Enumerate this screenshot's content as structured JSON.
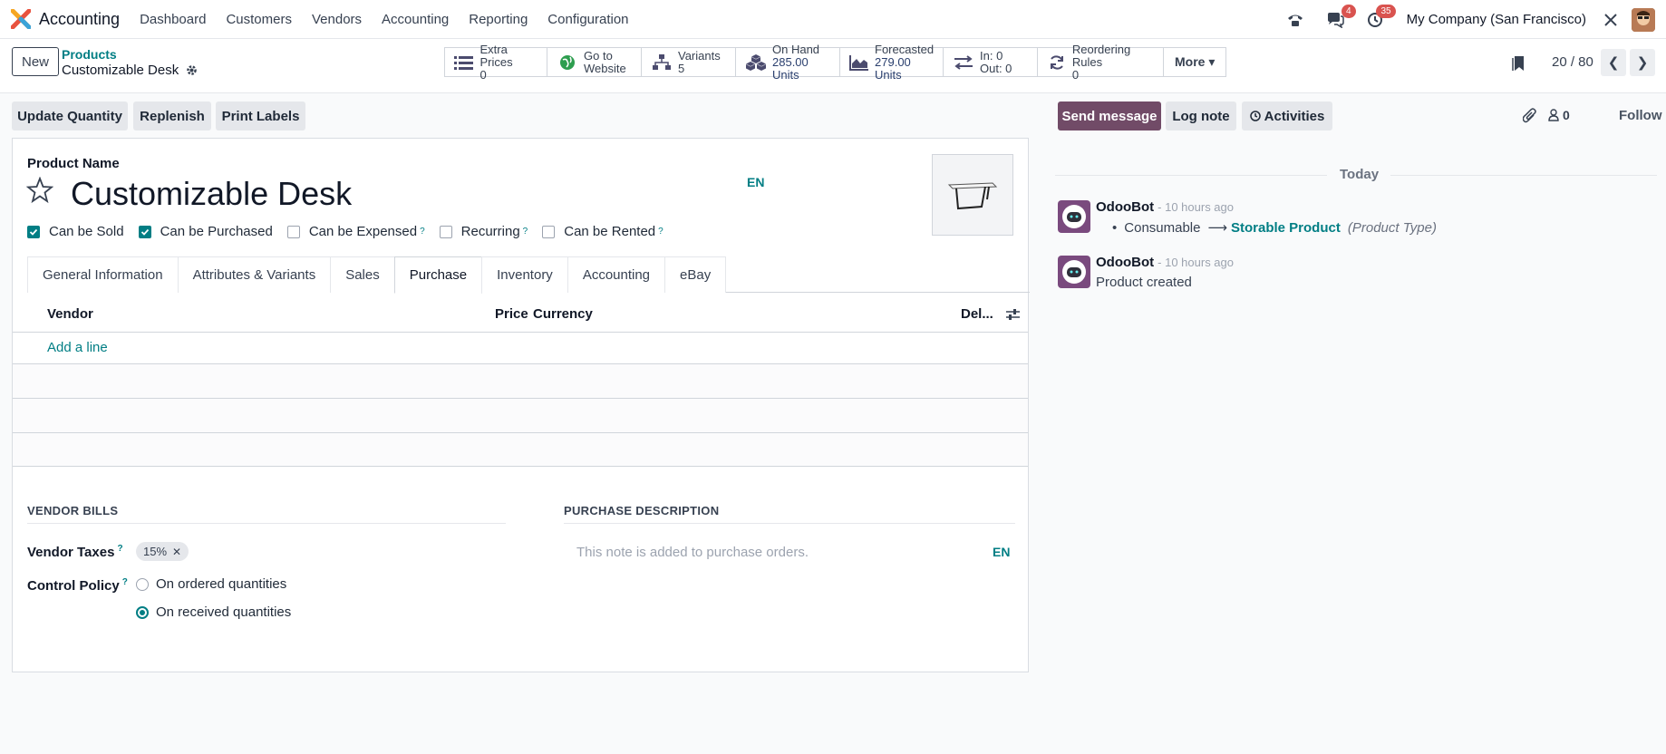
{
  "nav": {
    "app": "Accounting",
    "menu": [
      "Dashboard",
      "Customers",
      "Vendors",
      "Accounting",
      "Reporting",
      "Configuration"
    ],
    "messages_badge": "4",
    "activities_badge": "35",
    "company": "My Company (San Francisco)"
  },
  "breadcrumb": {
    "parent": "Products",
    "current": "Customizable Desk"
  },
  "buttons": {
    "new": "New",
    "more": "More ▾"
  },
  "smart_buttons": [
    {
      "label": "Extra Prices",
      "value": "0",
      "icon": "list-icon"
    },
    {
      "label": "Go to",
      "value": "Website",
      "icon": "globe-icon"
    },
    {
      "label": "Variants",
      "value": "5",
      "icon": "sitemap-icon"
    },
    {
      "label": "On Hand",
      "value": "285.00 Units",
      "icon": "cubes-icon"
    },
    {
      "label": "Forecasted",
      "value": "279.00 Units",
      "icon": "area-chart-icon"
    },
    {
      "label": "In: 0",
      "value": "Out: 0",
      "icon": "exchange-icon"
    },
    {
      "label": "Reordering Rules",
      "value": "0",
      "icon": "refresh-icon"
    }
  ],
  "pager": {
    "value": "20 / 80"
  },
  "actions": {
    "update_qty": "Update Quantity",
    "replenish": "Replenish",
    "print_labels": "Print Labels"
  },
  "form": {
    "product_name_label": "Product Name",
    "product_name": "Customizable Desk",
    "lang": "EN",
    "checkboxes": [
      {
        "label": "Can be Sold",
        "checked": true,
        "help": ""
      },
      {
        "label": "Can be Purchased",
        "checked": true,
        "help": ""
      },
      {
        "label": "Can be Expensed",
        "checked": false,
        "help": "?"
      },
      {
        "label": "Recurring",
        "checked": false,
        "help": "?"
      },
      {
        "label": "Can be Rented",
        "checked": false,
        "help": "?"
      }
    ],
    "tabs": [
      "General Information",
      "Attributes & Variants",
      "Sales",
      "Purchase",
      "Inventory",
      "Accounting",
      "eBay"
    ],
    "active_tab": "Purchase",
    "table_columns": {
      "vendor": "Vendor",
      "price": "Price",
      "currency": "Currency",
      "delivery": "Del..."
    },
    "add_line": "Add a line",
    "vendor_bills_title": "VENDOR BILLS",
    "purchase_desc_title": "PURCHASE DESCRIPTION",
    "vendor_taxes_label": "Vendor Taxes",
    "vendor_tax_tag": "15%",
    "control_policy_label": "Control Policy",
    "help_mark": "?",
    "policy_options": [
      {
        "label": "On ordered quantities",
        "selected": false
      },
      {
        "label": "On received quantities",
        "selected": true
      }
    ],
    "purchase_desc_placeholder": "This note is added to purchase orders.",
    "purchase_desc_lang": "EN"
  },
  "chatter": {
    "send_message": "Send message",
    "log_note": "Log note",
    "activities": "Activities",
    "followers_count": "0",
    "follow": "Follow",
    "date_separator": "Today",
    "messages": [
      {
        "author": "OdooBot",
        "time": "- 10 hours ago",
        "old": "Consumable",
        "arrow": "⟶",
        "new": "Storable Product",
        "field": "(Product Type)"
      },
      {
        "author": "OdooBot",
        "time": "- 10 hours ago",
        "body": "Product created"
      }
    ]
  },
  "colors": {
    "accent": "#017e84",
    "primary": "#714b67"
  }
}
